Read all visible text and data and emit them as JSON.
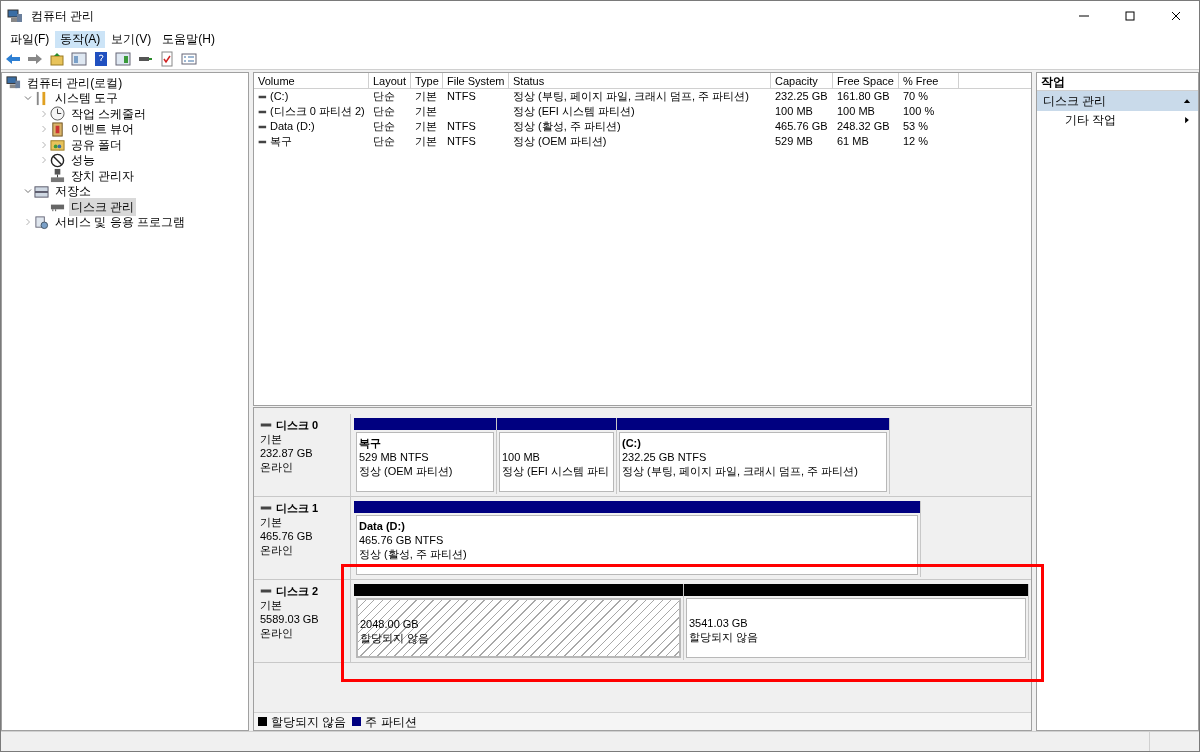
{
  "window": {
    "title": "컴퓨터 관리"
  },
  "menu": [
    {
      "label": "파일(F)",
      "selected": false
    },
    {
      "label": "동작(A)",
      "selected": true
    },
    {
      "label": "보기(V)",
      "selected": false
    },
    {
      "label": "도움말(H)",
      "selected": false
    }
  ],
  "tree": [
    {
      "label": "컴퓨터 관리(로컬)",
      "selected": false,
      "children": [
        {
          "label": "시스템 도구",
          "expanded": true,
          "selected": false,
          "children": [
            {
              "label": "작업 스케줄러",
              "expanded": false,
              "selected": false
            },
            {
              "label": "이벤트 뷰어",
              "expanded": false,
              "selected": false
            },
            {
              "label": "공유 폴더",
              "expanded": false,
              "selected": false
            },
            {
              "label": "성능",
              "expanded": false,
              "selected": false
            },
            {
              "label": "장치 관리자",
              "selected": false
            }
          ]
        },
        {
          "label": "저장소",
          "expanded": true,
          "selected": false,
          "children": [
            {
              "label": "디스크 관리",
              "selected": true
            }
          ]
        },
        {
          "label": "서비스 및 응용 프로그램",
          "expanded": false,
          "selected": false
        }
      ]
    }
  ],
  "table": {
    "columns": [
      "Volume",
      "Layout",
      "Type",
      "File System",
      "Status",
      "Capacity",
      "Free Space",
      "% Free"
    ],
    "rows": [
      [
        "(C:)",
        "단순",
        "기본",
        "NTFS",
        "정상 (부팅, 페이지 파일, 크래시 덤프, 주 파티션)",
        "232.25 GB",
        "161.80 GB",
        "70 %"
      ],
      [
        "(디스크 0 파티션 2)",
        "단순",
        "기본",
        "",
        "정상 (EFI 시스템 파티션)",
        "100 MB",
        "100 MB",
        "100 %"
      ],
      [
        "Data (D:)",
        "단순",
        "기본",
        "NTFS",
        "정상 (활성, 주 파티션)",
        "465.76 GB",
        "248.32 GB",
        "53 %"
      ],
      [
        "복구",
        "단순",
        "기본",
        "NTFS",
        "정상 (OEM 파티션)",
        "529 MB",
        "61 MB",
        "12 %"
      ]
    ]
  },
  "disks": [
    {
      "name": "디스크 0",
      "type": "기본",
      "size": "232.87 GB",
      "state": "온라인",
      "highlighted": false,
      "partitions": [
        {
          "kind": "primary",
          "selected": false,
          "title": "복구",
          "size": "529 MB NTFS",
          "status": "정상 (OEM 파티션)"
        },
        {
          "kind": "primary",
          "selected": false,
          "size": "100 MB",
          "status": "정상 (EFI 시스템 파티"
        },
        {
          "kind": "primary",
          "selected": false,
          "title": "(C:)",
          "size": "232.25 GB NTFS",
          "status": "정상 (부팅, 페이지 파일, 크래시 덤프, 주 파티션)"
        }
      ]
    },
    {
      "name": "디스크 1",
      "type": "기본",
      "size": "465.76 GB",
      "state": "온라인",
      "highlighted": false,
      "partitions": [
        {
          "kind": "primary",
          "selected": false,
          "title": "Data  (D:)",
          "size": "465.76 GB NTFS",
          "status": "정상 (활성, 주 파티션)"
        }
      ]
    },
    {
      "name": "디스크 2",
      "type": "기본",
      "size": "5589.03 GB",
      "state": "온라인",
      "highlighted": true,
      "partitions": [
        {
          "kind": "unallocated",
          "selected": true,
          "size": "2048.00 GB",
          "status": "할당되지 않음"
        },
        {
          "kind": "unallocated",
          "selected": false,
          "size": "3541.03 GB",
          "status": "할당되지 않음"
        }
      ]
    }
  ],
  "legend": [
    {
      "kind": "unallocated",
      "label": "할당되지 않음"
    },
    {
      "kind": "primary",
      "label": "주 파티션"
    }
  ],
  "actions": {
    "title": "작업",
    "section": "디스크 관리",
    "items": [
      "기타 작업"
    ]
  }
}
